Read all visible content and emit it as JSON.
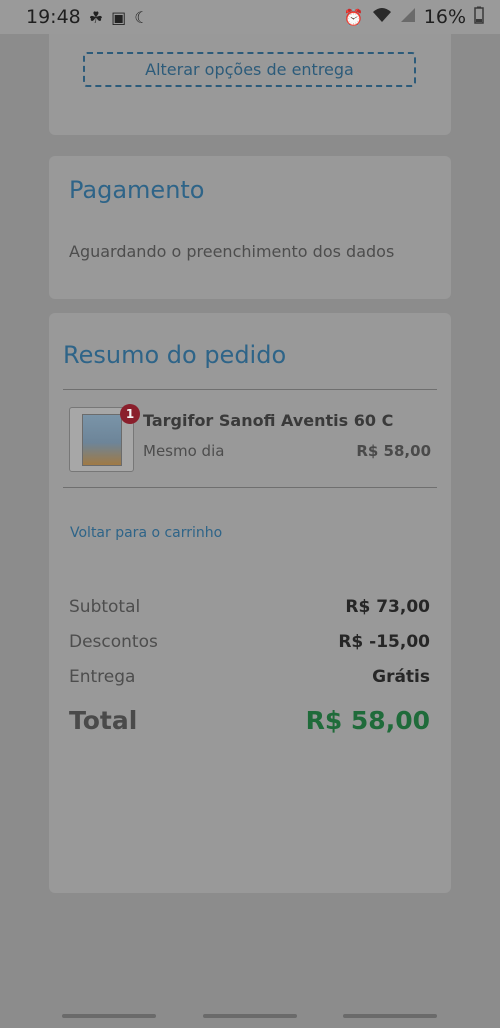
{
  "status_bar": {
    "time": "19:48",
    "battery": "16%",
    "left_icons": [
      "leaf-icon",
      "image-icon",
      "moon-icon"
    ],
    "right_icons": [
      "alarm-icon",
      "wifi-icon",
      "signal-icon",
      "battery-icon"
    ]
  },
  "delivery": {
    "change_options_label": "Alterar opções de entrega"
  },
  "payment": {
    "title": "Pagamento",
    "status_text": "Aguardando o preenchimento dos dados"
  },
  "summary": {
    "title": "Resumo do pedido",
    "items": [
      {
        "quantity": "1",
        "name": "Targifor Sanofi Aventis 60 C...",
        "shipping": "Mesmo dia",
        "price": "R$ 58,00"
      }
    ],
    "back_to_cart_label": "Voltar para o carrinho",
    "subtotal_label": "Subtotal",
    "subtotal_value": "R$ 73,00",
    "discounts_label": "Descontos",
    "discounts_value": "R$ -15,00",
    "delivery_label": "Entrega",
    "delivery_value": "Grátis",
    "total_label": "Total",
    "total_value": "R$ 58,00"
  },
  "colors": {
    "accent": "#2e6488",
    "total_green": "#1f6b3a",
    "badge_red": "#8a1f2c"
  }
}
